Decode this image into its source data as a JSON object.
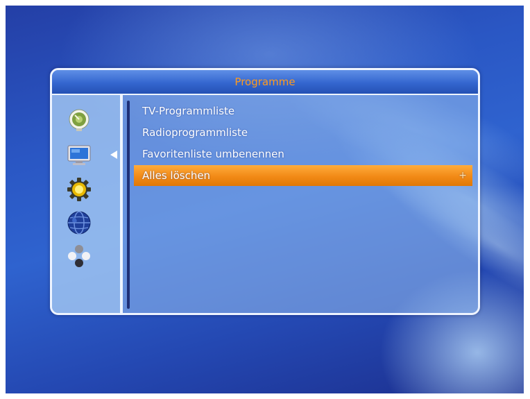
{
  "menu": {
    "title": "Programme",
    "categories": [
      {
        "icon": "satellite-dish-icon"
      },
      {
        "icon": "tv-icon",
        "active": true
      },
      {
        "icon": "gear-icon"
      },
      {
        "icon": "globe-icon"
      },
      {
        "icon": "puzzle-icon"
      }
    ],
    "items": [
      {
        "label": "TV-Programmliste"
      },
      {
        "label": "Radioprogrammliste"
      },
      {
        "label": "Favoritenliste umbenennen"
      },
      {
        "label": "Alles löschen",
        "selected": true,
        "arrow": "+"
      }
    ]
  },
  "colors": {
    "title_text": "#ff9a1e",
    "highlight": "#f28a16",
    "panel_border": "#eef4ff",
    "background_blue": "#2a57c4"
  }
}
